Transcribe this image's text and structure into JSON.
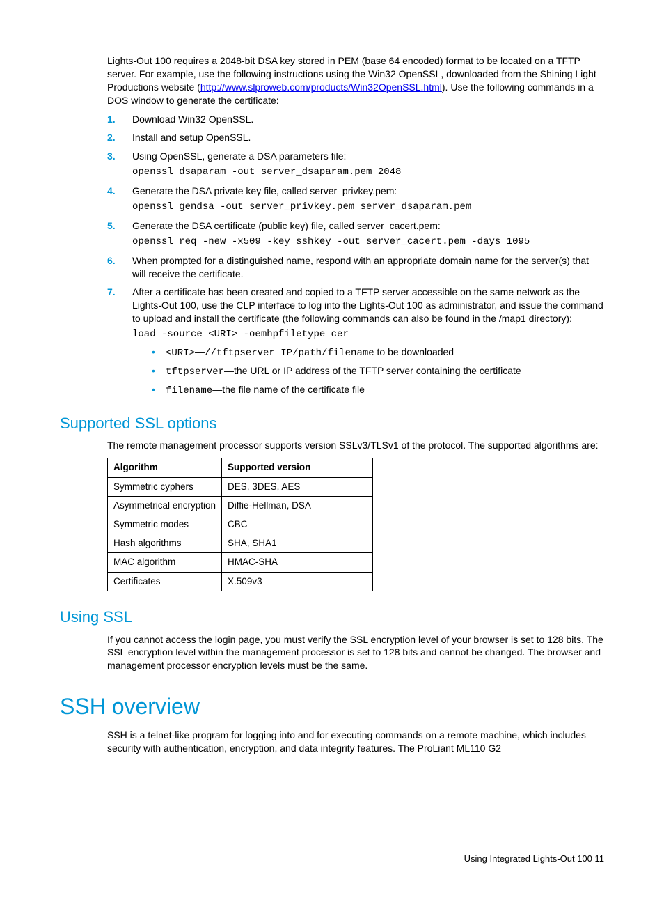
{
  "intro": {
    "prefix": "Lights-Out 100 requires a 2048-bit DSA key stored in PEM (base 64 encoded) format to be located on a TFTP server. For example, use the following instructions using the Win32 OpenSSL, downloaded from the Shining Light Productions website (",
    "link": "http://www.slproweb.com/products/Win32OpenSSL.html",
    "suffix": "). Use the following commands in a DOS window to generate the certificate:"
  },
  "steps": {
    "s1": {
      "num": "1.",
      "text": "Download Win32 OpenSSL."
    },
    "s2": {
      "num": "2.",
      "text": "Install and setup OpenSSL."
    },
    "s3": {
      "num": "3.",
      "text": "Using OpenSSL, generate a DSA parameters file:",
      "code": "openssl dsaparam -out server_dsaparam.pem 2048"
    },
    "s4": {
      "num": "4.",
      "text": "Generate the DSA private key file, called server_privkey.pem:",
      "code": "openssl gendsa -out server_privkey.pem server_dsaparam.pem"
    },
    "s5": {
      "num": "5.",
      "text": "Generate the DSA certificate (public key) file, called server_cacert.pem:",
      "code": "openssl req -new -x509 -key sshkey -out server_cacert.pem -days 1095"
    },
    "s6": {
      "num": "6.",
      "text": "When prompted for a distinguished name, respond with an appropriate domain name for the server(s) that will receive the certificate."
    },
    "s7": {
      "num": "7.",
      "text": "After a certificate has been created and copied to a TFTP server accessible on the same network as the Lights-Out 100, use the CLP interface to log into the Lights-Out 100 as administrator, and issue the command to upload and install the certificate (the following commands can also be found in the /map1 directory):",
      "code": "load -source <URI> -oemhpfiletype cer",
      "b1": {
        "code": "<URI>",
        "sep": "—",
        "code2": "//tftpserver IP/path/filename",
        "rest": " to be downloaded"
      },
      "b2": {
        "code": "tftpserver",
        "rest": "—the URL or IP address of the TFTP server containing the certificate"
      },
      "b3": {
        "code": "filename",
        "rest": "—the file name of the certificate file"
      }
    }
  },
  "ssl_options": {
    "heading": "Supported SSL options",
    "para": "The remote management processor supports version SSLv3/TLSv1 of the protocol. The supported algorithms are:"
  },
  "chart_data": {
    "type": "table",
    "headers": [
      "Algorithm",
      "Supported version"
    ],
    "rows": [
      [
        "Symmetric cyphers",
        "DES, 3DES, AES"
      ],
      [
        "Asymmetrical encryption",
        "Diffie-Hellman, DSA"
      ],
      [
        "Symmetric modes",
        "CBC"
      ],
      [
        "Hash algorithms",
        "SHA, SHA1"
      ],
      [
        "MAC algorithm",
        "HMAC-SHA"
      ],
      [
        "Certificates",
        "X.509v3"
      ]
    ]
  },
  "using_ssl": {
    "heading": "Using SSL",
    "para": "If you cannot access the login page, you must verify the SSL encryption level of your browser is set to 128 bits. The SSL encryption level within the management processor is set to 128 bits and cannot be changed. The browser and management processor encryption levels must be the same."
  },
  "ssh": {
    "heading": "SSH overview",
    "para": "SSH is a telnet-like program for logging into and for executing commands on a remote machine, which includes security with authentication, encryption, and data integrity features. The ProLiant ML110 G2"
  },
  "footer": {
    "text": "Using Integrated Lights-Out 100   11"
  }
}
